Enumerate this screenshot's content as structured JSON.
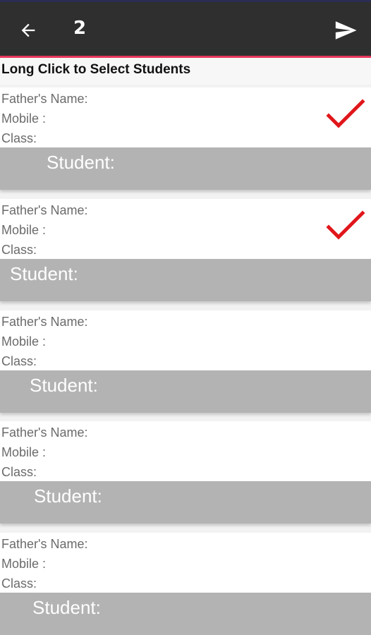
{
  "header": {
    "back_icon": "arrow-left-icon",
    "title": "2",
    "send_icon": "send-icon",
    "background": "#2f2f2f",
    "accent": "#e8365a"
  },
  "hint": "Long Click to Select Students",
  "cards": [
    {
      "father_label": "Father's Name:",
      "mobile_label": "Mobile :",
      "class_label": "Class:",
      "student_label": "Student:",
      "selected": true
    },
    {
      "father_label": "Father's Name:",
      "mobile_label": "Mobile :",
      "class_label": "Class:",
      "student_label": "Student:",
      "selected": true
    },
    {
      "father_label": "Father's Name:",
      "mobile_label": "Mobile :",
      "class_label": "Class:",
      "student_label": "Student:",
      "selected": false
    },
    {
      "father_label": "Father's Name:",
      "mobile_label": "Mobile :",
      "class_label": "Class:",
      "student_label": "Student:",
      "selected": false
    },
    {
      "father_label": "Father's Name:",
      "mobile_label": "Mobile :",
      "class_label": "Class:",
      "student_label": "Student:",
      "selected": false
    }
  ],
  "colors": {
    "check": "#e0161b",
    "student_bar": "#b3b3b3"
  }
}
